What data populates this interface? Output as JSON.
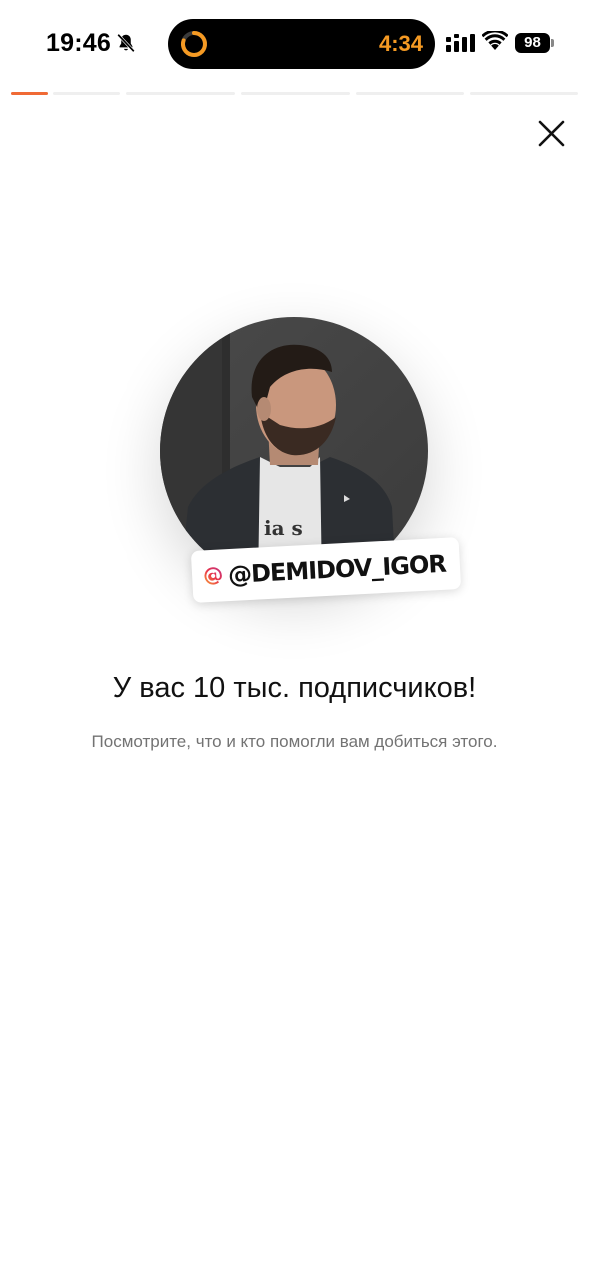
{
  "status_bar": {
    "time": "19:46",
    "timer": "4:34",
    "battery": "98",
    "icons": [
      "bell-slash-icon",
      "timer-ring-icon",
      "cellular-signal-icon",
      "wifi-icon",
      "battery-icon"
    ]
  },
  "progress": {
    "segments": 6,
    "current_index": 0,
    "current_fill": 1.0
  },
  "close_icon": "close-icon",
  "profile": {
    "handle": "@DEMIDOV_IGOR",
    "badge_icon": "threads-icon"
  },
  "message": {
    "title": "У вас 10 тыс. подписчиков!",
    "subtitle": "Посмотрите, что и кто помогли вам добиться этого."
  },
  "colors": {
    "accent": "#f06a35",
    "timer": "#f59a23",
    "text_primary": "#111111",
    "text_secondary": "#737373"
  }
}
